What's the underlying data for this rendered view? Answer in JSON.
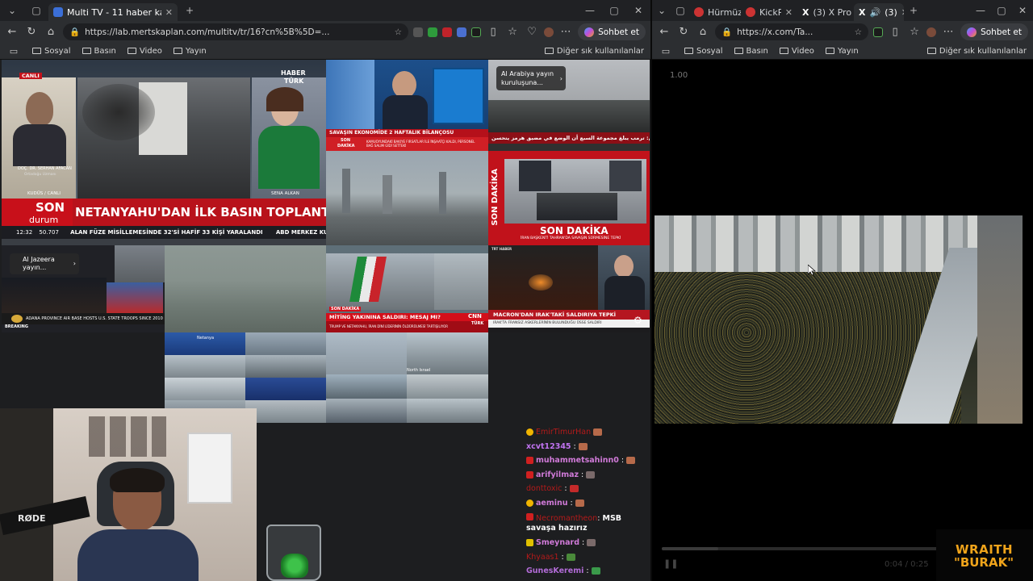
{
  "left_window": {
    "tabs": [
      {
        "title": "Multi TV - 11 haber kanalını aynı a",
        "active": true
      }
    ],
    "url": "https://lab.mertskaplan.com/multitv/tr/16?cn%5B%5D=...",
    "chat_button": "Sohbet et",
    "bookmarks": [
      "Sosyal",
      "Basın",
      "Video",
      "Yayın"
    ],
    "bookmarks_right": "Diğer sık kullanılanlar"
  },
  "right_window": {
    "tabs": [
      {
        "title": "Hürmüz",
        "active": false
      },
      {
        "title": "KickPeek",
        "active": false
      },
      {
        "title": "(3) X Pro",
        "active": false
      },
      {
        "title": "(3)",
        "active": true
      }
    ],
    "url": "https://x.com/Ta...",
    "chat_button": "Sohbet et",
    "bookmarks": [
      "Sosyal",
      "Basın",
      "Video",
      "Yayın"
    ],
    "bookmarks_right": "Diğer sık kullanılanlar",
    "speed_label": "1.00",
    "time_label": "0:04 / 0:25"
  },
  "tiles": {
    "haberturk": {
      "canli": "CANLI",
      "logo_top": "HABER",
      "logo_bottom": "TÜRK",
      "guest_caption": "DOÇ. DR. SERHAN AFACAN",
      "guest_sub": "Ortadoğu Uzmanı",
      "location": "KUDÜS / CANLI",
      "anchor": "SENA ALKAN",
      "son": "SON",
      "durum": "durum",
      "headline": "NETANYAHU'DAN İLK BASIN TOPLANTISI",
      "time": "12:32",
      "index": "50.707",
      "ticker": "ALAN FÜZE MİSİLLEMESİNDE 32'Sİ HAFİF 33 KİŞİ YARALANDI",
      "ticker2": "ABD MERKEZ KUVVETLE"
    },
    "studio": {
      "caption": "SAVAŞIN EKONOMİDE 2 HAFTALIK BİLANÇOSU",
      "son": "SON",
      "dakika": "DAKİKA",
      "sub": "KAMUOYUNDAKİ BAKIYE FIRSATLAR İLE İNŞAATÇI KALDI, PERSONEL BAĞ SALIM GİDİ SETTEKİ"
    },
    "arabiya": {
      "notice": "Al Arabiya yayın kuruluşuna...",
      "ticker": "اكسيوس: ترمب يبلغ مجموعة السبع أن الوضع في مضيق هرمز يتحسن"
    },
    "sondakika": {
      "side": "SON DAKİKA",
      "banner": "SON DAKİKA",
      "sub": "İRAN BAŞKENTİ TAHRAN'DA SAVAŞIN SÜRMESİNE TEPKİ"
    },
    "aljazeera": {
      "notice": "Al Jazeera yayın...",
      "ticker": "ADANA PROVINCE AIR BASE HOSTS U.S. STATE TROOPS SINCE 2010",
      "tag": "BREAKING"
    },
    "cnn": {
      "son": "SON DAKİKA",
      "headline": "MİTİNG YAKININA SALDIRI: MESAJ MI?",
      "sub": "TRUMP VE NETANYAHU, İRAN DİNİ LİDERİNİN ÖLDÜRÜLMESİ TARTIŞILIYOR",
      "logo_a": "CNN",
      "logo_b": "TÜRK"
    },
    "trt": {
      "headline": "MACRON'DAN IRAK'TAKİ SALDIRIYA TEPKİ",
      "sub": "IRAK'TA FRANSIZ ASKERLERİNİN BULUNDUĞU ÜSSE SALDIRI",
      "logo": "TRT HABER"
    },
    "cams_a_label": "Netanya",
    "cams_b_label": "North Israel"
  },
  "chat": [
    {
      "user": "EmirTimurHan",
      "msg": "",
      "color": "#b41a1a",
      "badge": "#f0b400"
    },
    {
      "user": "xcvt12345",
      "msg": "",
      "color": "#c073f0",
      "badge": ""
    },
    {
      "user": "muhammetsahinn0",
      "msg": "",
      "color": "#d07ad8",
      "badge": "#d02020"
    },
    {
      "user": "arifyilmaz",
      "msg": "",
      "color": "#d07ad8",
      "badge": "#d02020"
    },
    {
      "user": "donttoxic",
      "msg": "",
      "color": "#b41a1a",
      "badge": ""
    },
    {
      "user": "aeminu",
      "msg": "",
      "color": "#d07ad8",
      "badge": "#f0b400"
    },
    {
      "user": "Necromantheon",
      "msg": "MSB savaşa hazırız",
      "color": "#b41a1a",
      "badge": "#d02020"
    },
    {
      "user": "Smeynard",
      "msg": "",
      "color": "#d07ad8",
      "badge": "#e0c000"
    },
    {
      "user": "Khyaas1",
      "msg": "",
      "color": "#b41a1a",
      "badge": ""
    },
    {
      "user": "GunesKeremi",
      "msg": "",
      "color": "#b16bd6",
      "badge": ""
    }
  ],
  "overlay": {
    "brand_top": "WRAITH",
    "brand_bottom": "\"BURAK\"",
    "mic": "RØDE"
  }
}
